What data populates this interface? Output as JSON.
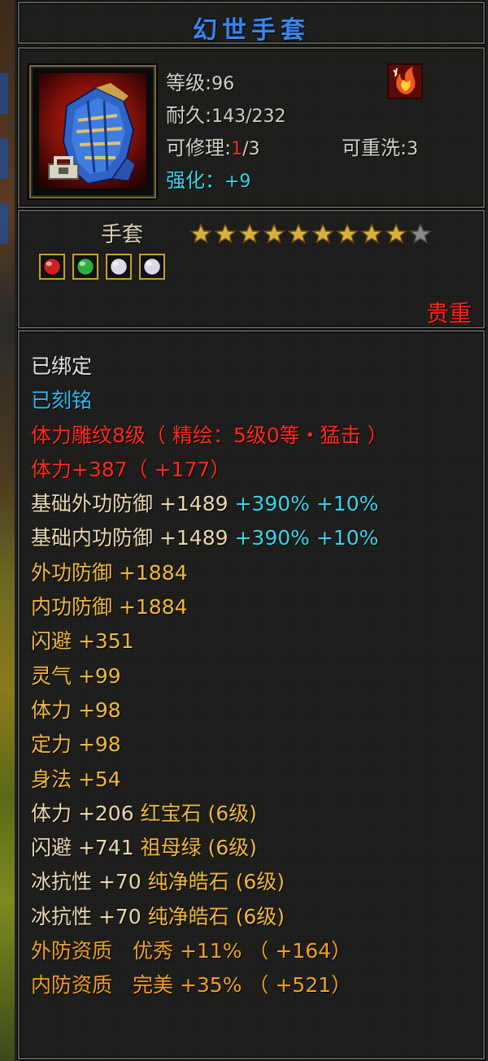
{
  "item": {
    "name": "幻世手套",
    "level_label": "等级",
    "level_value": "96",
    "durability_label": "耐久",
    "durability_value": "143/232",
    "repair_label": "可修理",
    "repair_used": "1",
    "repair_total": "/3",
    "rewash_label": "可重洗",
    "rewash_value": "3",
    "enhance_label": "强化：",
    "enhance_value": "+9",
    "type": "手套",
    "rarity": "贵重",
    "star_rating": 9,
    "star_max": 10
  },
  "gems": [
    {
      "name": "ruby-gem",
      "color": "#d02020"
    },
    {
      "name": "emerald-gem",
      "color": "#30b040"
    },
    {
      "name": "diamond-gem",
      "color": "#d8d8e8"
    },
    {
      "name": "diamond-gem",
      "color": "#d8d8e8"
    }
  ],
  "colors": {
    "title": "#3b86e6",
    "red": "#ff2a1e",
    "cyan": "#35d6ea",
    "gold": "#f0b838",
    "orange": "#f0a020",
    "tan": "#e8d8b0"
  },
  "attributes": [
    {
      "parts": [
        {
          "text": "已绑定",
          "color": "white"
        }
      ]
    },
    {
      "parts": [
        {
          "text": "已刻铭",
          "color": "blue"
        }
      ]
    },
    {
      "parts": [
        {
          "text": "体力雕纹8级（ 精绘：5级0等・猛击 ）",
          "color": "red"
        }
      ]
    },
    {
      "parts": [
        {
          "text": "体力+387（ +177）",
          "color": "red"
        }
      ]
    },
    {
      "parts": [
        {
          "text": "基础外功防御 +1489 ",
          "color": "tan"
        },
        {
          "text": "+390% +10%",
          "color": "cyan"
        }
      ]
    },
    {
      "parts": [
        {
          "text": "基础内功防御 +1489 ",
          "color": "tan"
        },
        {
          "text": "+390% +10%",
          "color": "cyan"
        }
      ]
    },
    {
      "parts": [
        {
          "text": "外功防御 +1884",
          "color": "gold"
        }
      ]
    },
    {
      "parts": [
        {
          "text": "内功防御 +1884",
          "color": "gold"
        }
      ]
    },
    {
      "parts": [
        {
          "text": "闪避 +351",
          "color": "gold"
        }
      ]
    },
    {
      "parts": [
        {
          "text": "灵气 +99",
          "color": "gold"
        }
      ]
    },
    {
      "parts": [
        {
          "text": "体力 +98",
          "color": "gold"
        }
      ]
    },
    {
      "parts": [
        {
          "text": "定力 +98",
          "color": "gold"
        }
      ]
    },
    {
      "parts": [
        {
          "text": "身法 +54",
          "color": "gold"
        }
      ]
    },
    {
      "parts": [
        {
          "text": "体力 +206 ",
          "color": "tan"
        },
        {
          "text": "红宝石 (6级)",
          "color": "gold"
        }
      ]
    },
    {
      "parts": [
        {
          "text": "闪避 +741 ",
          "color": "tan"
        },
        {
          "text": "祖母绿 (6级)",
          "color": "gold"
        }
      ]
    },
    {
      "parts": [
        {
          "text": "冰抗性 +70 ",
          "color": "tan"
        },
        {
          "text": "纯净皓石 (6级)",
          "color": "gold"
        }
      ]
    },
    {
      "parts": [
        {
          "text": "冰抗性 +70 ",
          "color": "tan"
        },
        {
          "text": "纯净皓石 (6级)",
          "color": "gold"
        }
      ]
    },
    {
      "parts": [
        {
          "text": "外防资质　优秀 +11% （ +164）",
          "color": "orange"
        }
      ]
    },
    {
      "parts": [
        {
          "text": "内防资质　完美 +35% （ +521）",
          "color": "orange"
        }
      ]
    }
  ]
}
